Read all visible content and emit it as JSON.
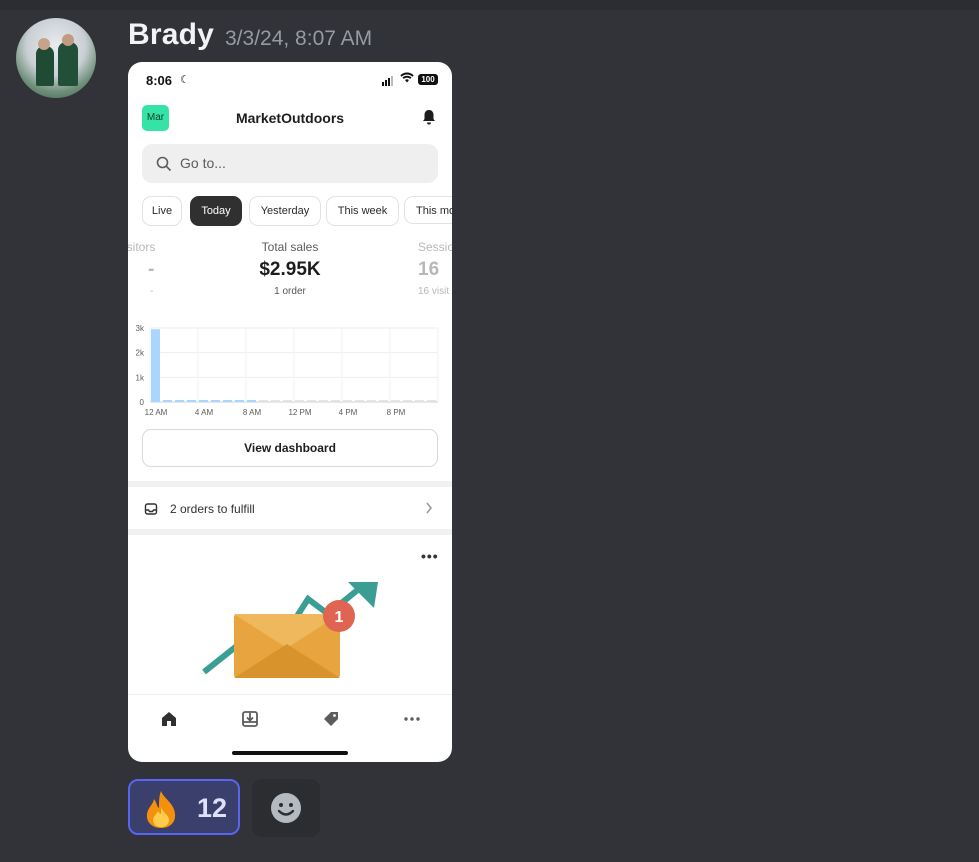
{
  "message": {
    "author": "Brady",
    "timestamp": "3/3/24, 8:07 AM"
  },
  "phone": {
    "status": {
      "time": "8:06",
      "battery": "100"
    },
    "header": {
      "store_badge": "Mar",
      "store_name": "MarketOutdoors"
    },
    "search": {
      "placeholder": "Go to..."
    },
    "filters": [
      "Live",
      "Today",
      "Yesterday",
      "This week",
      "This mo"
    ],
    "active_filter": "Today",
    "metrics": [
      {
        "label": "isitors",
        "value": "-",
        "sub": "-"
      },
      {
        "label": "Total sales",
        "value": "$2.95K",
        "sub": "1 order"
      },
      {
        "label": "Sessio",
        "value": "16",
        "sub": "16 visit"
      }
    ],
    "view_dashboard_label": "View dashboard",
    "orders_to_fulfill": "2 orders to fulfill",
    "card_menu": "•••",
    "notification_badge": "1",
    "tabs": [
      "home-icon",
      "orders-icon",
      "tag-icon",
      "more-icon"
    ]
  },
  "chart_data": {
    "type": "bar",
    "categories": [
      "12 AM",
      "1 AM",
      "2 AM",
      "3 AM",
      "4 AM",
      "5 AM",
      "6 AM",
      "7 AM",
      "8 AM",
      "9 AM",
      "10 AM",
      "11 AM",
      "12 PM",
      "1 PM",
      "2 PM",
      "3 PM",
      "4 PM",
      "5 PM",
      "6 PM",
      "7 PM",
      "8 PM",
      "9 PM",
      "10 PM",
      "11 PM"
    ],
    "values": [
      2950,
      0,
      0,
      0,
      0,
      0,
      0,
      0,
      0,
      0,
      0,
      0,
      0,
      0,
      0,
      0,
      0,
      0,
      0,
      0,
      0,
      0,
      0,
      0
    ],
    "x_tick_labels": [
      "12 AM",
      "4 AM",
      "8 AM",
      "12 PM",
      "4 PM",
      "8 PM"
    ],
    "y_tick_labels": [
      "0",
      "1k",
      "2k",
      "3k"
    ],
    "ylim": [
      0,
      3000
    ],
    "grid": true,
    "colors": {
      "bar": "#a9d6ff",
      "future": "#e3e3e3"
    }
  },
  "reactions": [
    {
      "emoji": "fire",
      "count": "12",
      "selected": true
    }
  ],
  "colors": {
    "background": "#313338",
    "accent": "#5865f2",
    "store_badge": "#34e3a5"
  }
}
